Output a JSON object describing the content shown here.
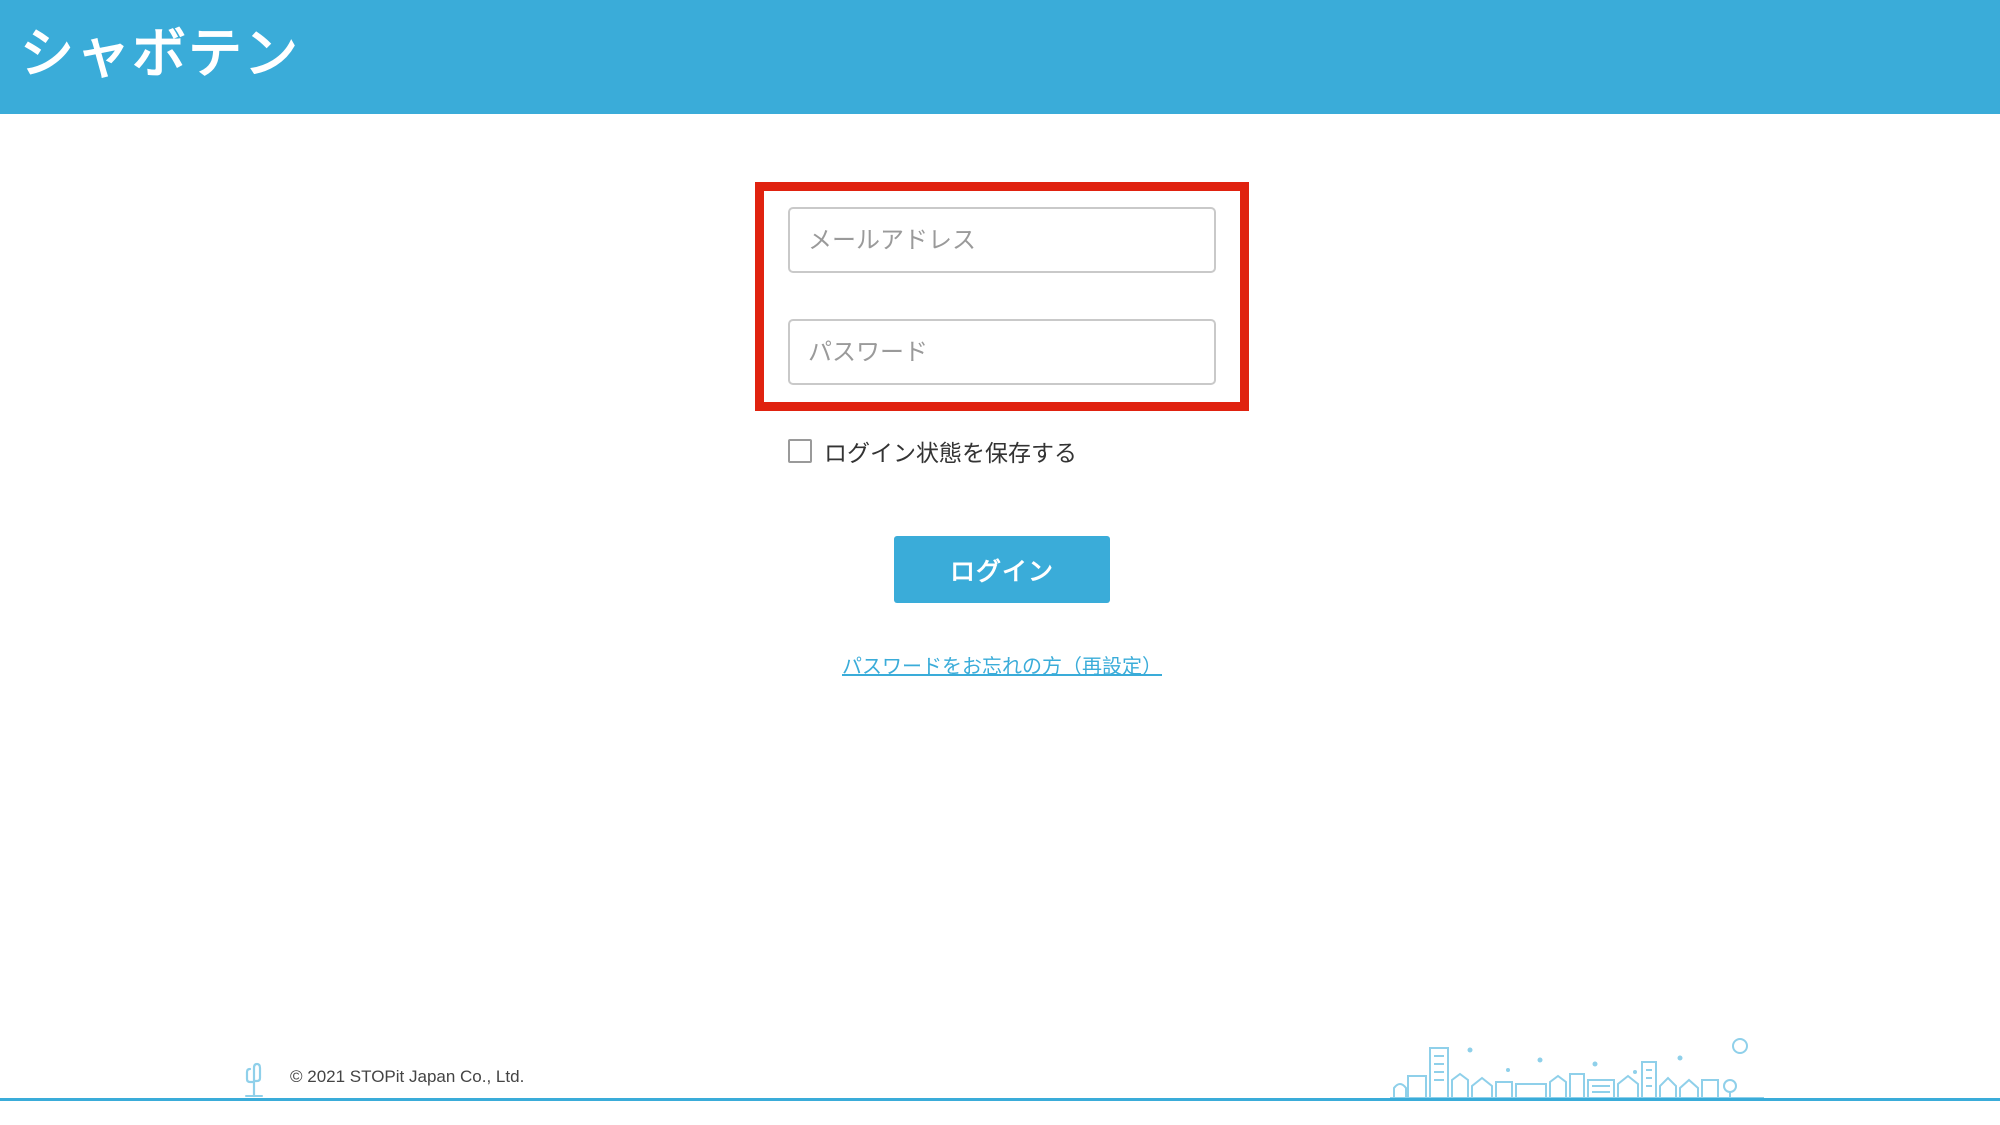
{
  "header": {
    "logo_text": "シャボテン",
    "color": "#3aacd9"
  },
  "form": {
    "email": {
      "placeholder": "メールアドレス",
      "value": ""
    },
    "password": {
      "placeholder": "パスワード",
      "value": ""
    },
    "remember": {
      "label": "ログイン状態を保存する",
      "checked": false
    },
    "login_label": "ログイン",
    "forgot_link": "パスワードをお忘れの方（再設定）"
  },
  "annotation": {
    "highlight_color": "#e0220f"
  },
  "footer": {
    "copyright": "© 2021 STOPit Japan Co., Ltd.",
    "cactus_icon": "cactus-icon",
    "skyline_icon": "city-skyline-illustration"
  }
}
